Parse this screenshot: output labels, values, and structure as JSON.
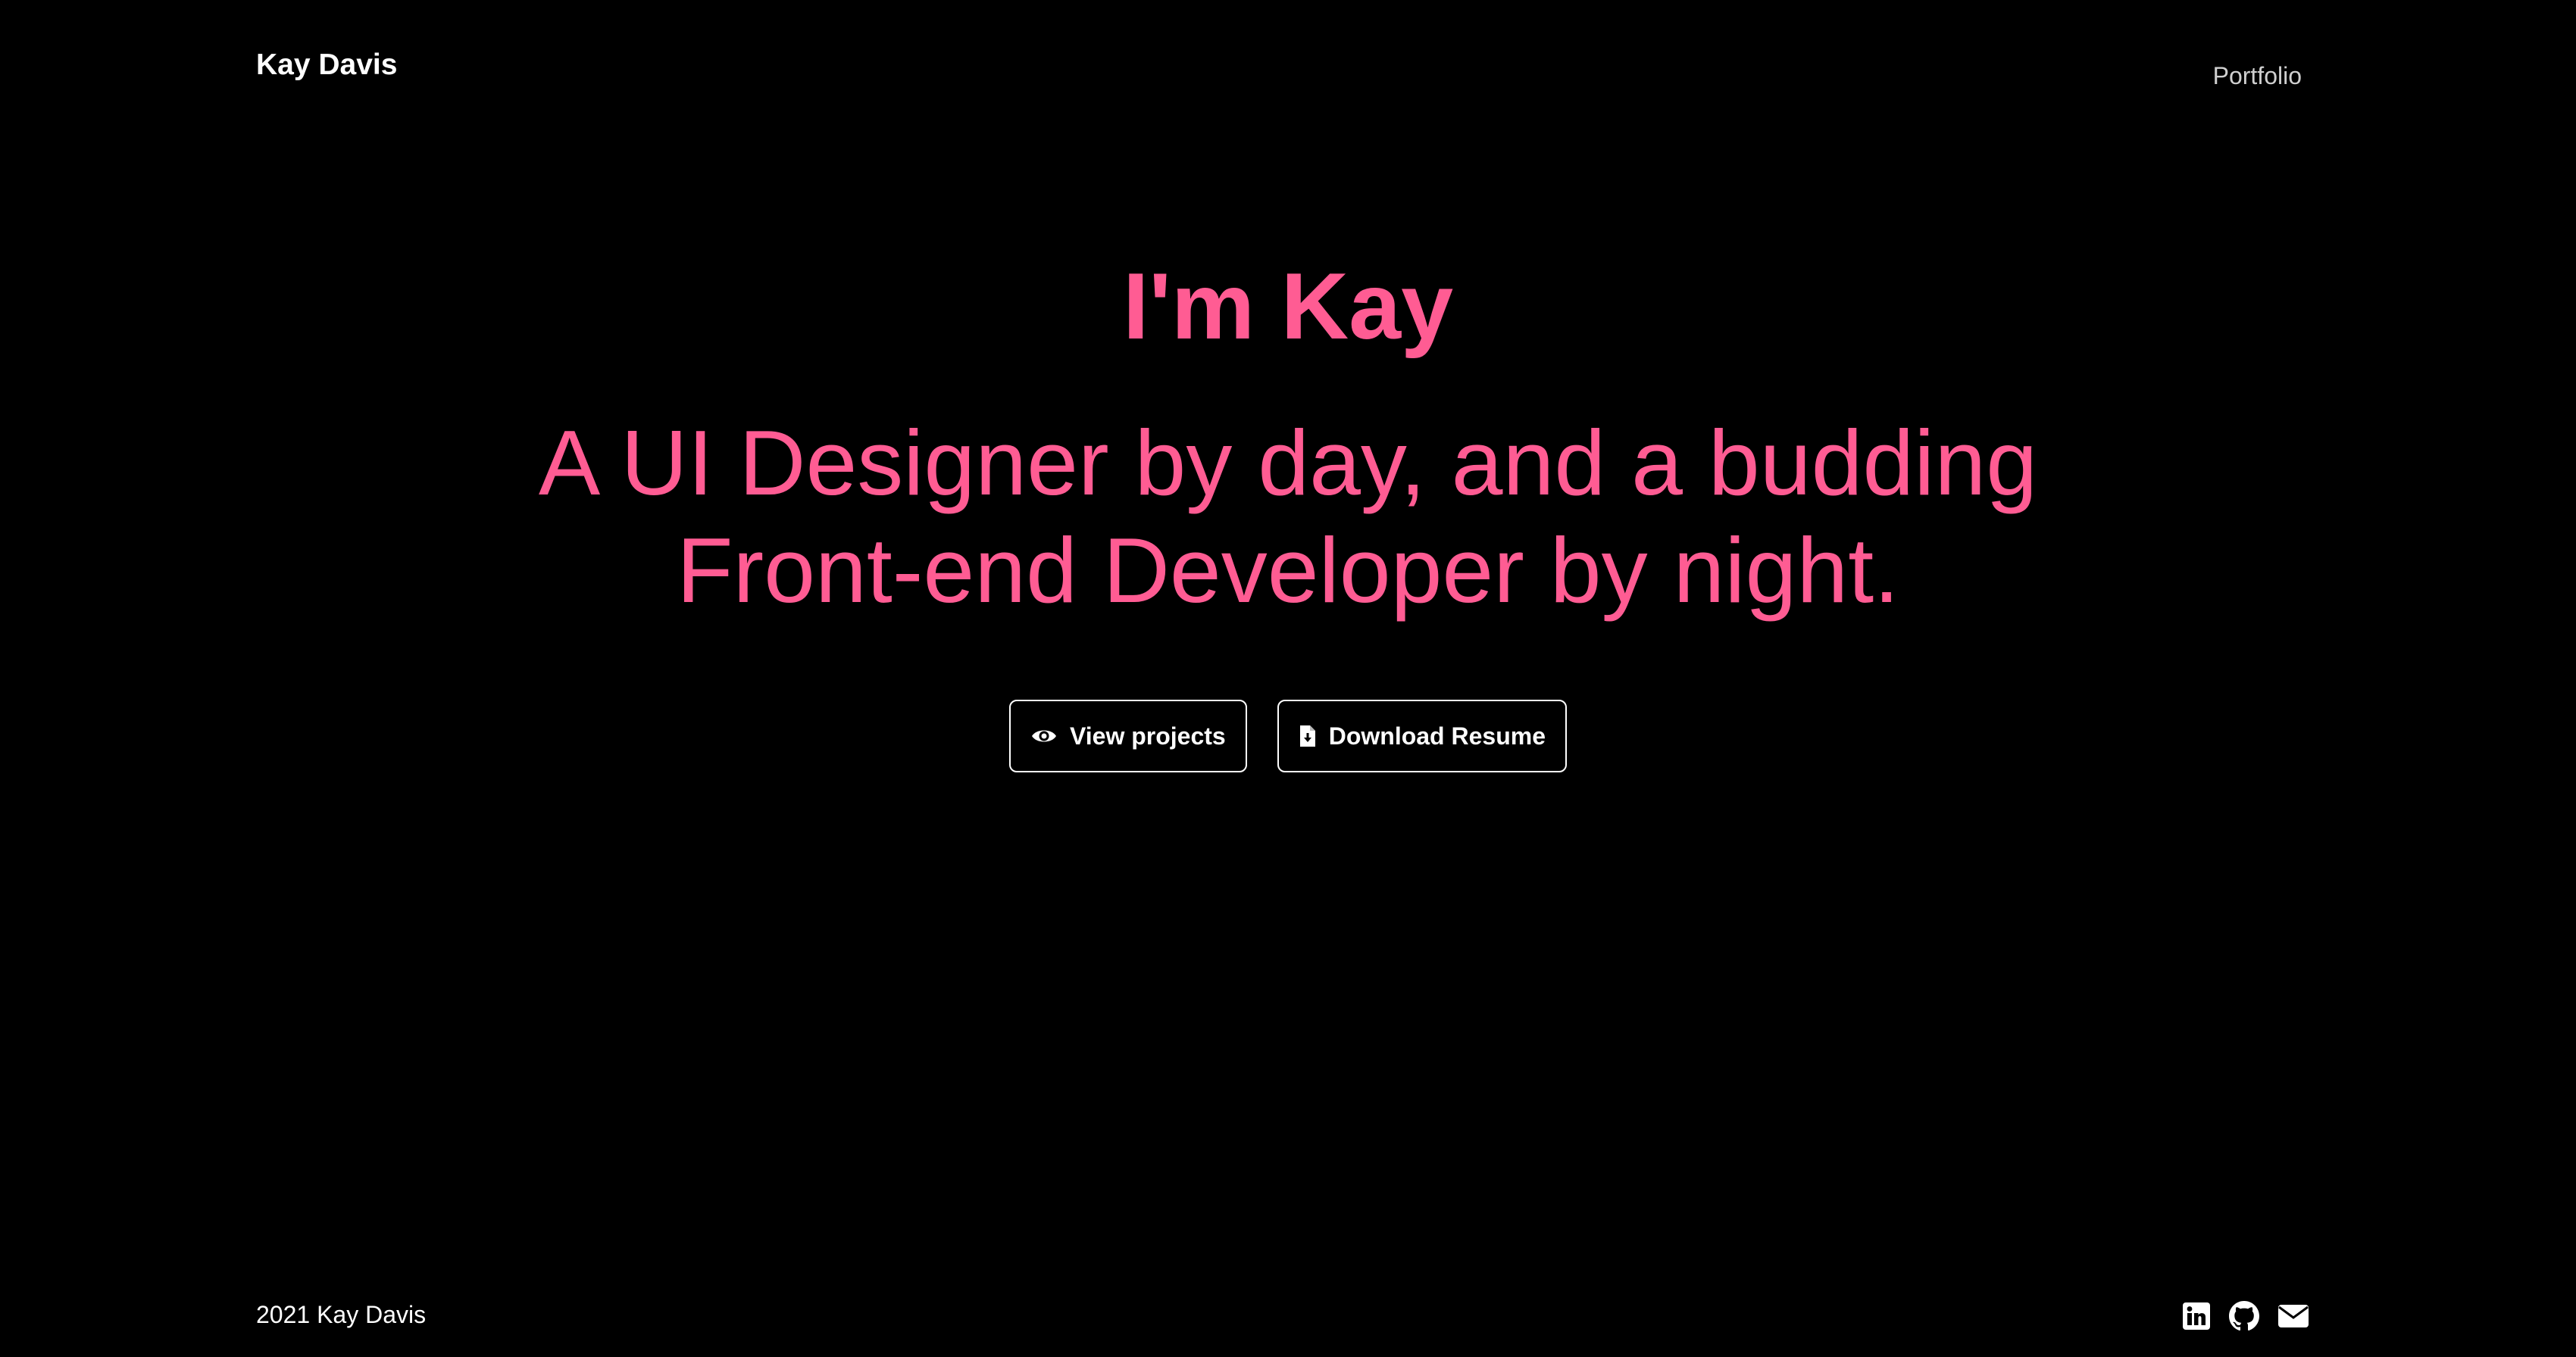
{
  "header": {
    "brand": "Kay Davis",
    "nav": [
      {
        "label": "Portfolio"
      }
    ]
  },
  "hero": {
    "title": "I'm Kay",
    "subtitle": "A UI Designer by day, and a budding Front-end Developer by night."
  },
  "actions": {
    "view_projects": {
      "label": "View projects",
      "icon": "eye-icon"
    },
    "download_resume": {
      "label": "Download Resume",
      "icon": "file-download-icon"
    }
  },
  "footer": {
    "copyright": "2021 Kay Davis",
    "social": [
      {
        "icon": "linkedin-icon"
      },
      {
        "icon": "github-icon"
      },
      {
        "icon": "envelope-icon"
      }
    ]
  },
  "colors": {
    "background": "#000000",
    "accent": "#ff5c93",
    "text": "#ffffff",
    "nav_text": "#cfcfcf"
  }
}
